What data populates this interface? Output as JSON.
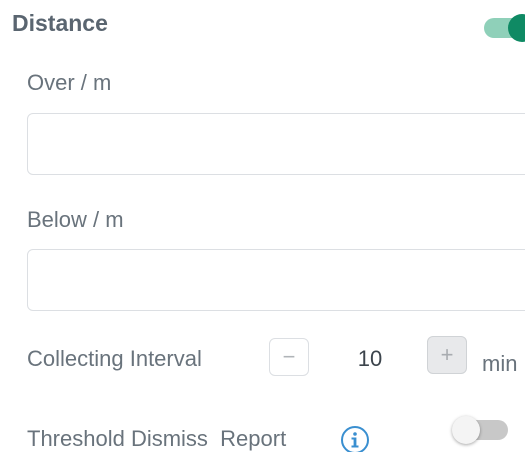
{
  "section": {
    "title": "Distance",
    "enabled": true
  },
  "over": {
    "label": "Over / m",
    "value": "",
    "placeholder": ""
  },
  "below": {
    "label": "Below / m",
    "value": "",
    "placeholder": ""
  },
  "interval": {
    "label": "Collecting Interval",
    "minus_symbol": "−",
    "value": "10",
    "plus_symbol": "+",
    "unit": "min"
  },
  "threshold_dismiss": {
    "label": "Threshold Dismiss  Report",
    "enabled": false,
    "info_icon": "info-circle-icon"
  },
  "colors": {
    "accent": "#0f8a64",
    "accent_track": "#8fd0b9",
    "title_text": "#5a6570",
    "label_text": "#69737c",
    "info_icon": "#3a8fd0"
  }
}
